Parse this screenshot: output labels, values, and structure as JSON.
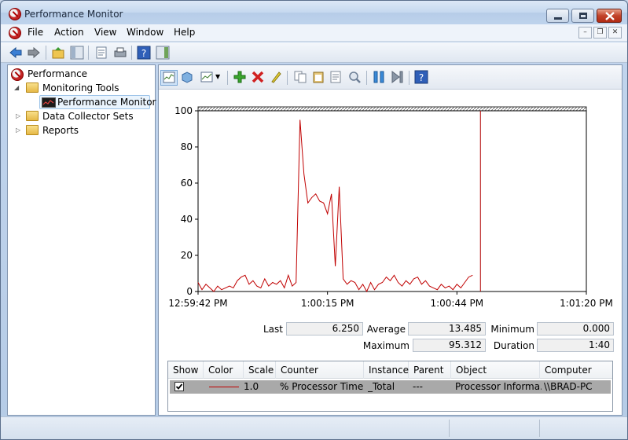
{
  "window": {
    "title": "Performance Monitor"
  },
  "menu": {
    "items": [
      "File",
      "Action",
      "View",
      "Window",
      "Help"
    ]
  },
  "tree": {
    "root": "Performance",
    "monitoring_tools": "Monitoring Tools",
    "performance_monitor": "Performance Monitor",
    "data_collector_sets": "Data Collector Sets",
    "reports": "Reports"
  },
  "stats": {
    "last_label": "Last",
    "last_value": "6.250",
    "average_label": "Average",
    "average_value": "13.485",
    "minimum_label": "Minimum",
    "minimum_value": "0.000",
    "maximum_label": "Maximum",
    "maximum_value": "95.312",
    "duration_label": "Duration",
    "duration_value": "1:40"
  },
  "legend": {
    "headers": {
      "show": "Show",
      "color": "Color",
      "scale": "Scale",
      "counter": "Counter",
      "instance": "Instance",
      "parent": "Parent",
      "object": "Object",
      "computer": "Computer"
    },
    "row": {
      "checked": true,
      "scale": "1.0",
      "counter": "% Processor Time",
      "instance": "_Total",
      "parent": "---",
      "object": "Processor Informa...",
      "computer": "\\\\BRAD-PC"
    }
  },
  "colors": {
    "series": "#c00000",
    "current_time_marker": "#b00000"
  },
  "chart_data": {
    "type": "line",
    "ylim": [
      0,
      100
    ],
    "y_ticks": [
      0,
      20,
      40,
      60,
      80,
      100
    ],
    "x_tick_labels": [
      "12:59:42 PM",
      "1:00:15 PM",
      "1:00:44 PM",
      "1:01:20 PM"
    ],
    "series": [
      {
        "name": "% Processor Time",
        "values": [
          5,
          1,
          4,
          2,
          0,
          3,
          1,
          2,
          3,
          2,
          6,
          8,
          9,
          4,
          6,
          3,
          2,
          7,
          3,
          5,
          4,
          6,
          2,
          9,
          3,
          5,
          95,
          65,
          49,
          52,
          54,
          50,
          49,
          43,
          54,
          14,
          58,
          7,
          4,
          6,
          5,
          1,
          4,
          0,
          5,
          1,
          4,
          5,
          8,
          6,
          9,
          5,
          3,
          6,
          4,
          7,
          8,
          4,
          6,
          3,
          2,
          1,
          4,
          2,
          3,
          1,
          4,
          2,
          5,
          8,
          9
        ]
      }
    ],
    "current_index": 72,
    "total_points": 100
  }
}
